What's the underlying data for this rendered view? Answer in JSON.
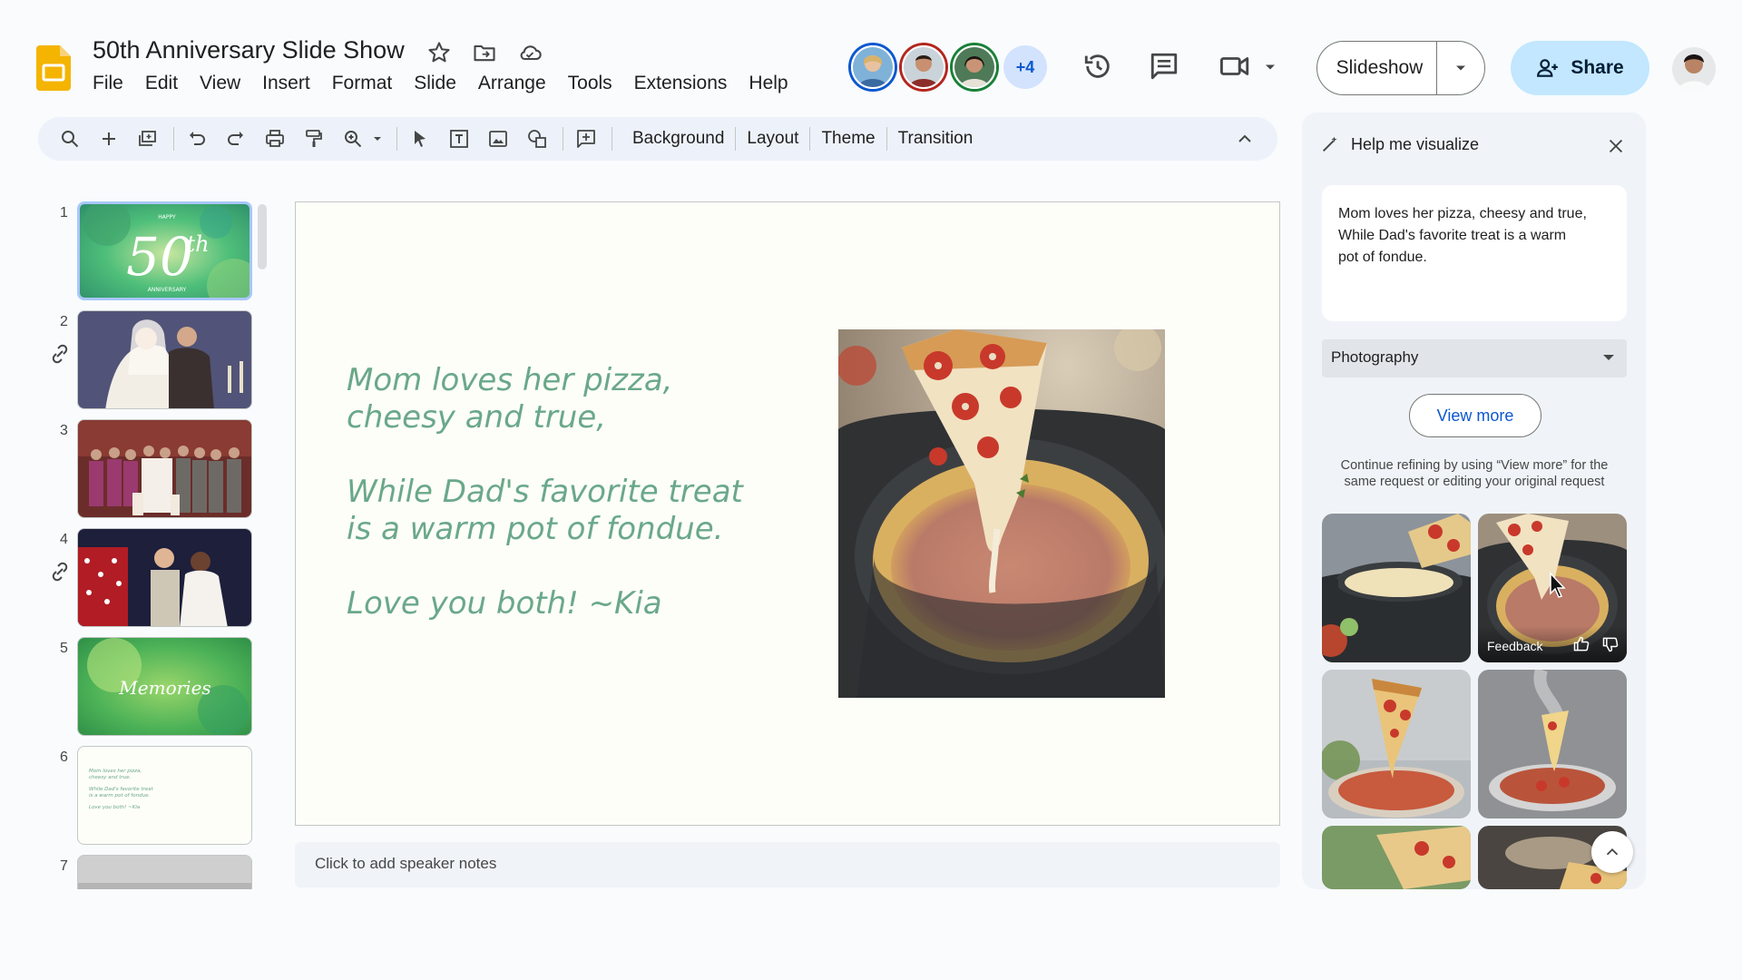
{
  "document": {
    "title": "50th Anniversary Slide Show"
  },
  "menu": [
    "File",
    "Edit",
    "View",
    "Insert",
    "Format",
    "Slide",
    "Arrange",
    "Tools",
    "Extensions",
    "Help"
  ],
  "collaborators": {
    "more_count": "+4"
  },
  "header": {
    "slideshow_label": "Slideshow",
    "share_label": "Share"
  },
  "toolbar": {
    "background_label": "Background",
    "layout_label": "Layout",
    "theme_label": "Theme",
    "transition_label": "Transition"
  },
  "filmstrip": {
    "numbers": [
      "1",
      "2",
      "3",
      "4",
      "5",
      "6",
      "7"
    ],
    "thumb1_small": "HAPPY",
    "thumb1_big": "50",
    "thumb1_sup": "th",
    "thumb1_sub": "ANNIVERSARY",
    "thumb5_text": "Memories",
    "thumb6_lines": [
      "Mom loves her pizza,",
      "cheesy and true.",
      "",
      "While Dad's favorite treat",
      "is a warm pot of fondue.",
      "",
      "Love you both! ~Kia"
    ]
  },
  "slide": {
    "stanza1_line1": "Mom loves her pizza,",
    "stanza1_line2": "cheesy and true,",
    "stanza2_line1": "While Dad's favorite treat",
    "stanza2_line2": "is a warm pot of fondue.",
    "stanza3_line1": "Love you both! ~Kia"
  },
  "notes": {
    "placeholder": "Click to add speaker notes"
  },
  "panel": {
    "title": "Help me visualize",
    "prompt_line1": "Mom loves her pizza, cheesy and true,",
    "prompt_line2": "While Dad's favorite treat is a warm",
    "prompt_line3": "pot of fondue.",
    "style_value": "Photography",
    "view_more_label": "View more",
    "hint_line1": "Continue refining by using “View more” for the",
    "hint_line2": "same request or editing your original request",
    "feedback_label": "Feedback"
  },
  "colors": {
    "accent": "#0b57d0",
    "share_bg": "#c2e7ff",
    "poem_text": "#6aa88a",
    "toolbar_bg": "#edf2fa",
    "panel_bg": "#f0f4f9"
  }
}
